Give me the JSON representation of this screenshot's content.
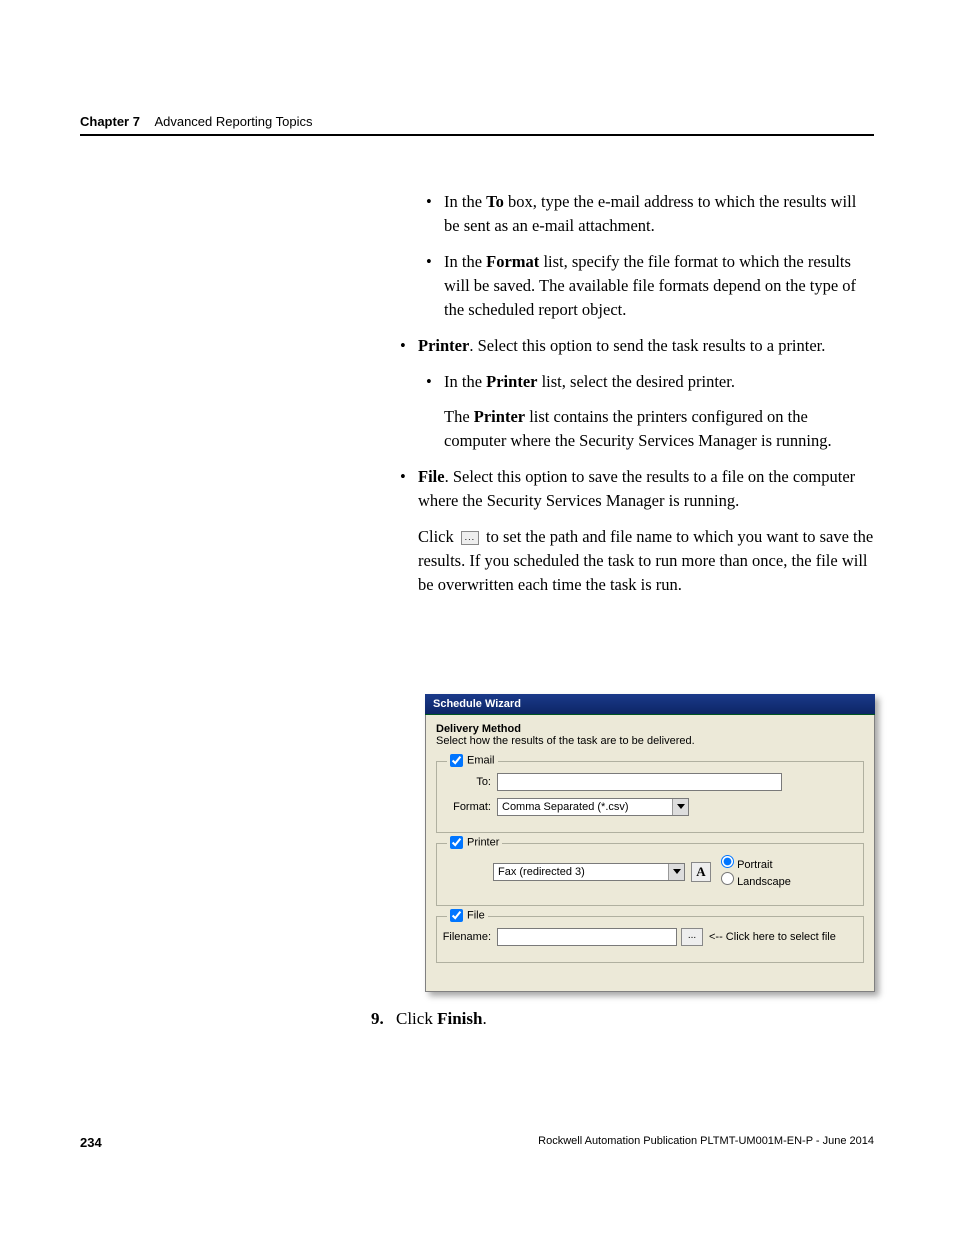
{
  "header": {
    "chapter": "Chapter 7",
    "title": "Advanced Reporting Topics"
  },
  "body": {
    "to_bullet_pre": "In the ",
    "to_bold": "To",
    "to_bullet_post": " box, type the e-mail address to which the results will be sent as an e-mail attachment.",
    "fmt_pre": "In the ",
    "fmt_bold": "Format",
    "fmt_post": " list, specify the file format to which the results will be saved. The available file formats depend on the type of the scheduled report object.",
    "printer_bold": "Printer",
    "printer_rest": ". Select this option to send the task results to a printer.",
    "printer_sub_pre": "In the ",
    "printer_sub_bold": "Printer",
    "printer_sub_post": " list, select the desired printer.",
    "printer_note_pre": "The ",
    "printer_note_bold": "Printer",
    "printer_note_post": " list contains the printers configured on the computer where the Security Services Manager is running.",
    "file_bold": "File",
    "file_rest": ". Select this option to save the results to a file on the computer where the Security Services Manager is running.",
    "click_word": "Click ",
    "click_rest": " to set the path and file name to which you want to save the results. If you scheduled the task to run more than once, the file will be overwritten each time the task is run."
  },
  "dialog": {
    "title": "Schedule Wizard",
    "section_title": "Delivery Method",
    "section_desc": "Select how the results of the task are to be delivered.",
    "email_legend": "Email",
    "to_label": "To:",
    "format_label": "Format:",
    "format_value": "Comma Separated (*.csv)",
    "printer_legend": "Printer",
    "printer_value": "Fax (redirected 3)",
    "icon_A": "A",
    "portrait": "Portrait",
    "landscape": "Landscape",
    "file_legend": "File",
    "filename_label": "Filename:",
    "ellipsis": "...",
    "file_hint": "<-- Click here to select file"
  },
  "step": {
    "num": "9.",
    "pre": "Click ",
    "bold": "Finish",
    "post": "."
  },
  "footer": {
    "page": "234",
    "pub": "Rockwell Automation Publication PLTMT-UM001M-EN-P - June 2014"
  }
}
